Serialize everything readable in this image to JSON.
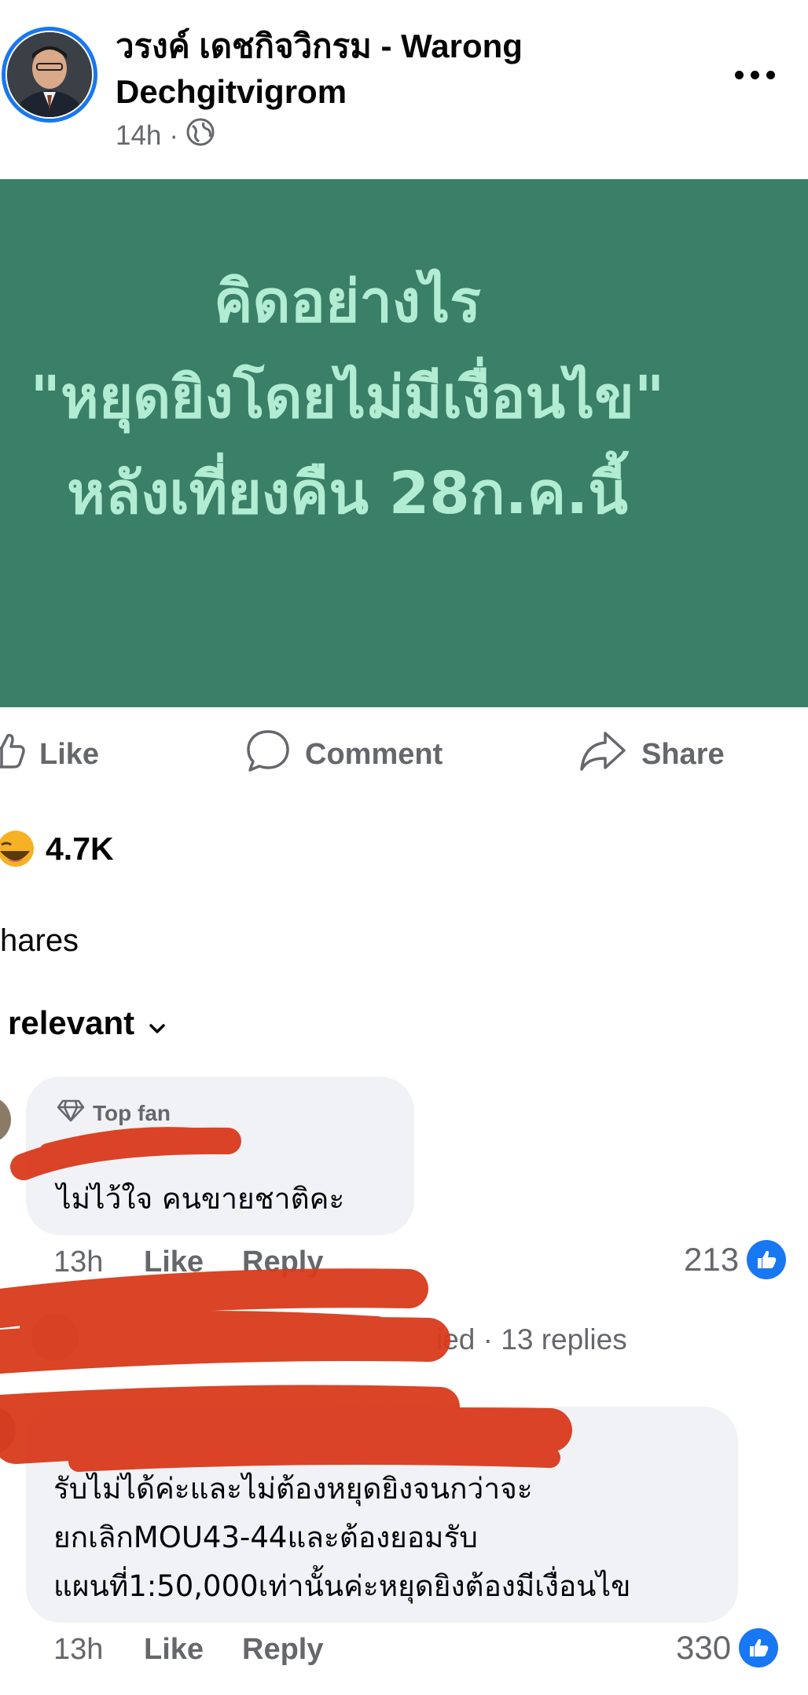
{
  "post": {
    "author": "วรงค์ เดชกิจวิกรม - Warong Dechgitvigrom",
    "time": "14h",
    "separator": "·",
    "privacy_icon": "globe-icon",
    "more_icon": "ellipsis-icon",
    "image_text": {
      "line1": "คิดอย่างไร",
      "line2": "\"หยุดยิงโดยไม่มีเงื่อนไข\"",
      "line3": "หลังเที่ยงคืน 28ก.ค.นี้"
    }
  },
  "actions": {
    "like": "Like",
    "comment": "Comment",
    "share": "Share"
  },
  "stats": {
    "reactions_count": "4.7K",
    "shares": "hares"
  },
  "sort": {
    "label": "relevant"
  },
  "comments": [
    {
      "badge": "Top fan",
      "text": "ไม่ไว้ใจ  คนขายชาติคะ",
      "time": "13h",
      "like": "Like",
      "reply": "Reply",
      "likes": "213"
    },
    {
      "replies_fragment": "ied",
      "replies": "· 13 replies"
    },
    {
      "text_lines": [
        "รับไม่ได้ค่ะและไม่ต้องหยุดยิงจนกว่าจะ",
        "ยกเลิกMOU43-44และต้องยอมรับ",
        "แผนที่1:50,000เท่านั้นค่ะหยุดยิงต้องมีเงื่อนไข"
      ],
      "time": "13h",
      "like": "Like",
      "reply": "Reply",
      "likes": "330"
    }
  ],
  "colors": {
    "image_bg": "#3a7f68",
    "image_text": "#b2ecd3",
    "accent": "#1877f2",
    "redaction": "#d93a1c",
    "muted": "#65676b"
  }
}
